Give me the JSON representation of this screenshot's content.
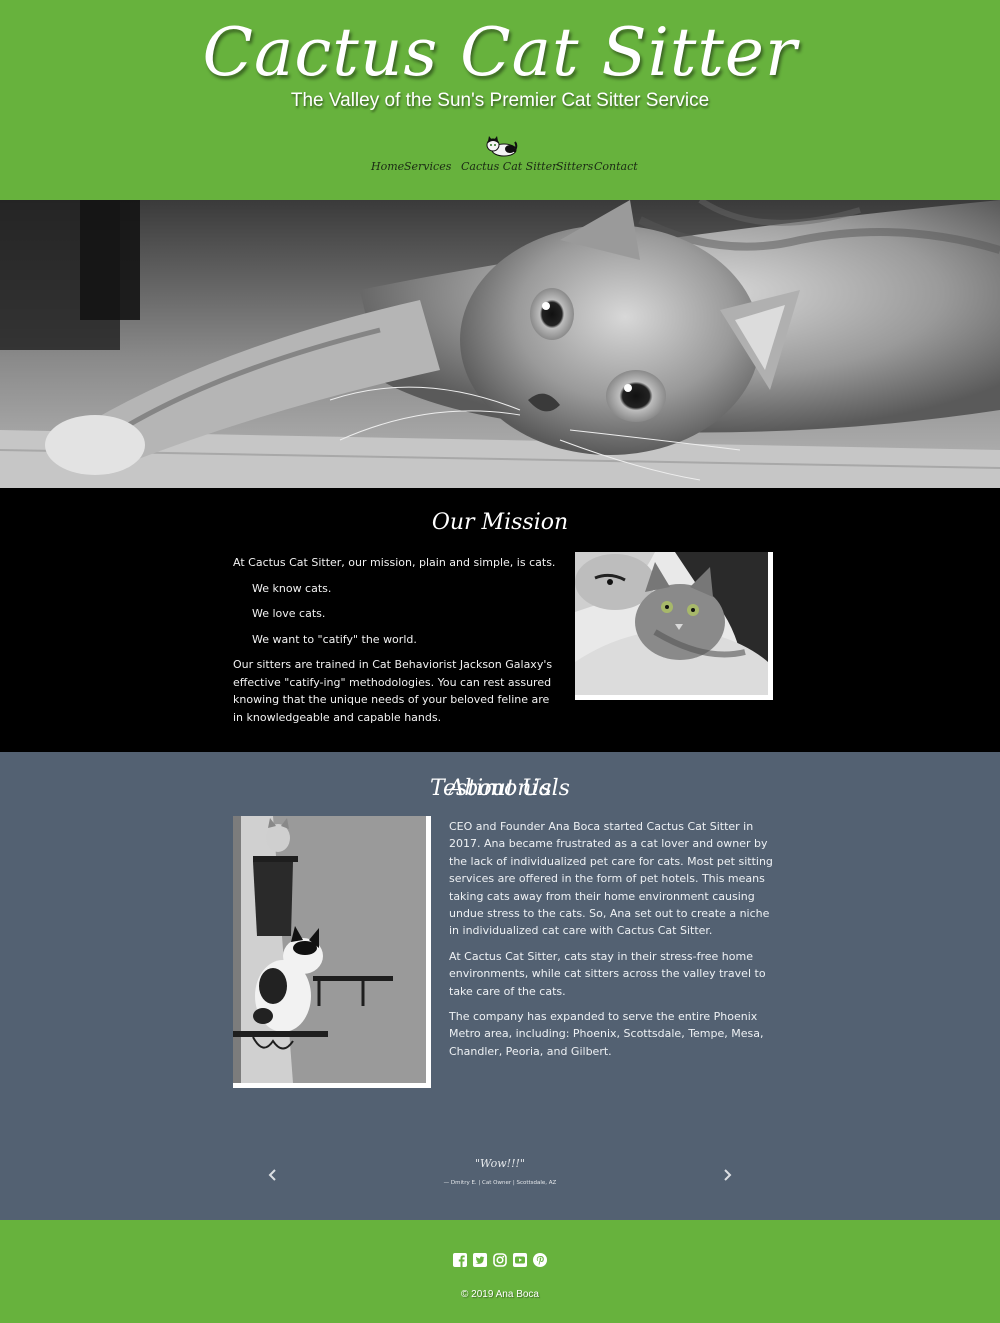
{
  "header": {
    "brand": "Cactus Cat Sitter",
    "tagline": "The Valley of the Sun's Premier Cat Sitter Service",
    "logo_icon": "cat-logo-icon",
    "nav": [
      {
        "label": "Home"
      },
      {
        "label": "Services"
      },
      {
        "label": "Cactus Cat Sitter"
      },
      {
        "label": "Sitters"
      },
      {
        "label": "Contact"
      }
    ]
  },
  "mission": {
    "title": "Our Mission",
    "paragraphs": [
      "At Cactus Cat Sitter, our mission, plain and simple, is cats.",
      "We know cats.",
      "We love cats.",
      "We want to \"catify\" the world.",
      "Our sitters are trained in Cat Behaviorist Jackson Galaxy's effective \"catify-ing\" methodologies. You can rest assured knowing that the unique needs of your beloved feline are in knowledgeable and capable hands."
    ]
  },
  "about": {
    "title": "About Us",
    "paragraphs": [
      "CEO and Founder Ana Boca started Cactus Cat Sitter in 2017. Ana became frustrated as a cat lover and owner by the lack of individualized pet care for cats. Most pet sitting services are offered in the form of pet hotels. This means taking cats away from their home environment causing undue stress to the cats. So, Ana set out to create a niche in individualized cat care with Cactus Cat Sitter.",
      "At Cactus Cat Sitter, cats stay in their stress-free home environments, while cat sitters across the valley travel to take care of the cats.",
      "The company has expanded to serve the entire Phoenix Metro area, including: Phoenix, Scottsdale, Tempe, Mesa, Chandler, Peoria, and Gilbert."
    ]
  },
  "testimonials": {
    "title": "Testimonials",
    "quote": "\"Wow!!!\"",
    "cite": "— Dmitry E. | Cat Owner | Scottsdale, AZ"
  },
  "footer": {
    "social_icons": [
      "facebook-icon",
      "twitter-icon",
      "instagram-icon",
      "youtube-icon",
      "pinterest-icon"
    ],
    "copyright": "© 2019 Ana Boca"
  },
  "colors": {
    "green": "#67b23d",
    "slate": "#536172",
    "black": "#000000"
  }
}
